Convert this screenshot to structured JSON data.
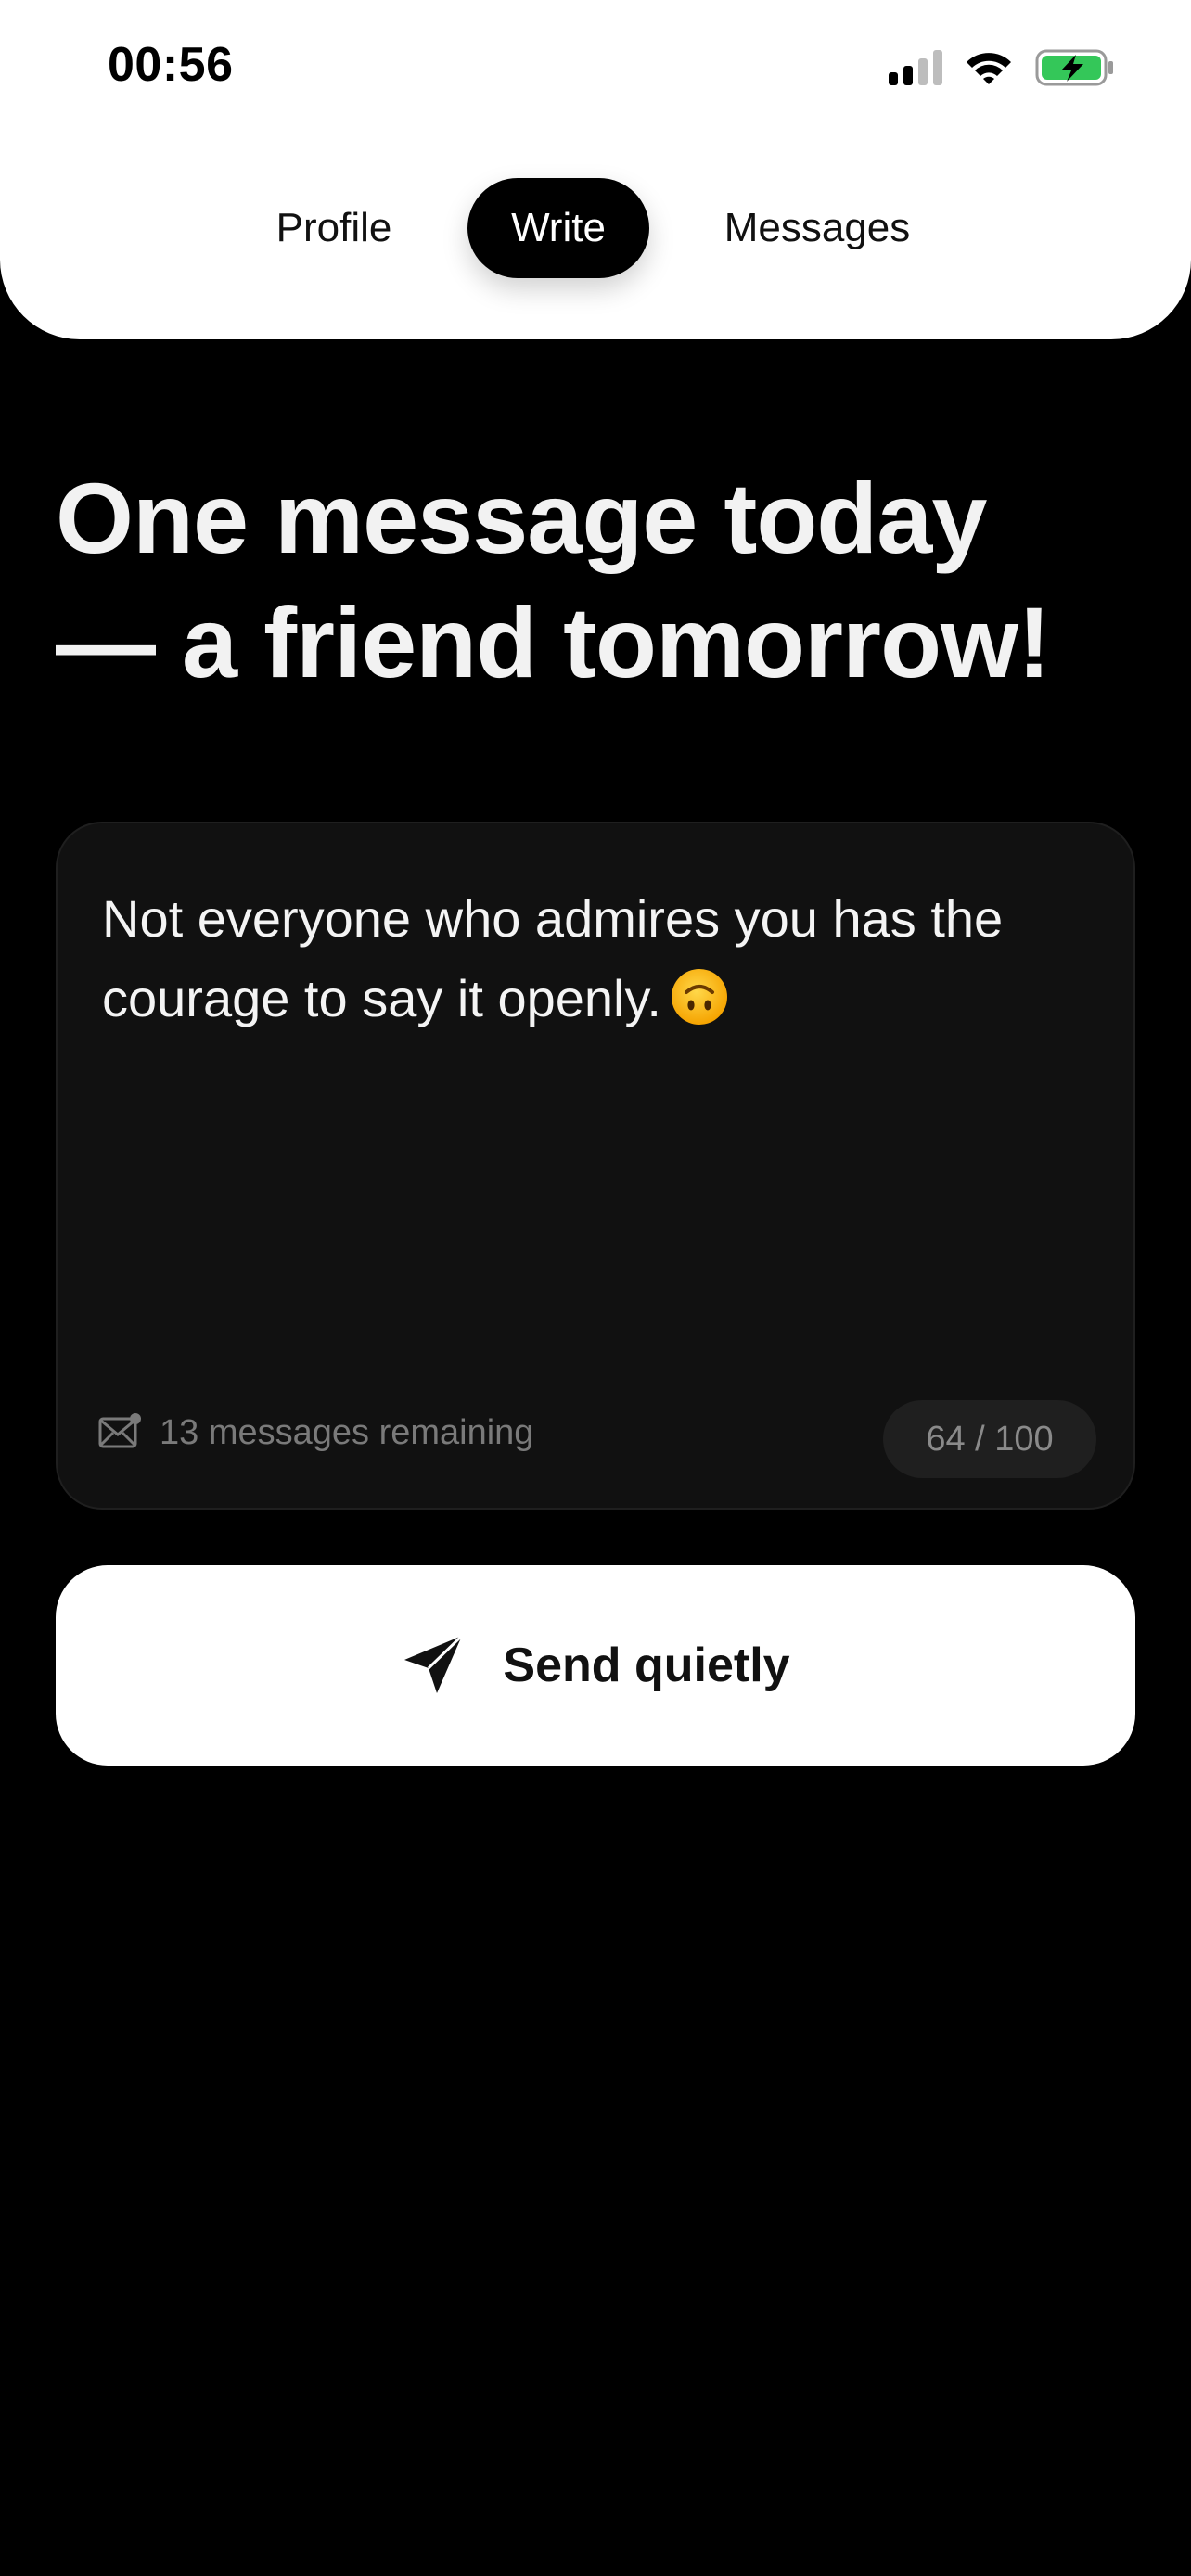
{
  "status_bar": {
    "time": "00:56",
    "icons": [
      "cellular-signal-icon",
      "wifi-icon",
      "battery-charging-icon"
    ],
    "battery_color": "#34C759"
  },
  "tabs": [
    {
      "label": "Profile",
      "active": false
    },
    {
      "label": "Write",
      "active": true
    },
    {
      "label": "Messages",
      "active": false
    }
  ],
  "headline": {
    "line1": "One message today",
    "line2": "— a friend tomorrow!"
  },
  "message": {
    "text": "Not everyone who admires you has the courage to say it openly.",
    "emoji": "upside-down-face-icon",
    "remaining": "13 messages remaining",
    "counter": "64 / 100"
  },
  "send_button": {
    "label": "Send quietly",
    "icon": "send-icon"
  },
  "colors": {
    "background": "#000000",
    "card": "#111111",
    "accent": "#ffffff"
  }
}
